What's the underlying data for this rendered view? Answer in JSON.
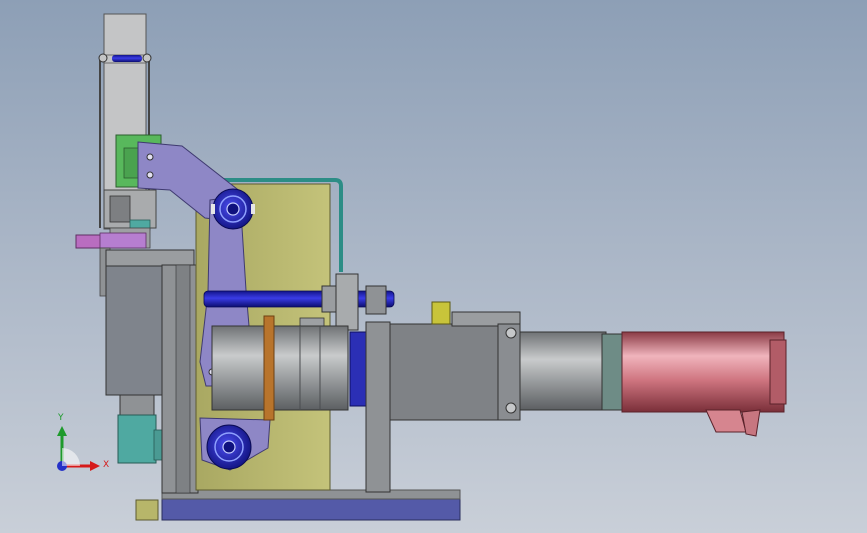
{
  "view": {
    "background_top": "#8d9fb6",
    "background_bottom": "#c9cfd8"
  },
  "triad": {
    "x_label": "X",
    "y_label": "Y",
    "x_color": "#d61a1a",
    "y_color": "#1e9a2c",
    "z_color": "#2430c8"
  },
  "colors": {
    "frame_gray": "#8f9295",
    "olive_plate": "#b7b66a",
    "blue_shaft": "#1d1fb8",
    "lavender_link": "#8e87c6",
    "base_plate": "#545aa8",
    "motor_red": "#c9707a",
    "teal_block": "#4fa9a1",
    "green_block": "#58b85c",
    "magenta_block": "#b96dc0",
    "copper_ring": "#b8742c"
  }
}
